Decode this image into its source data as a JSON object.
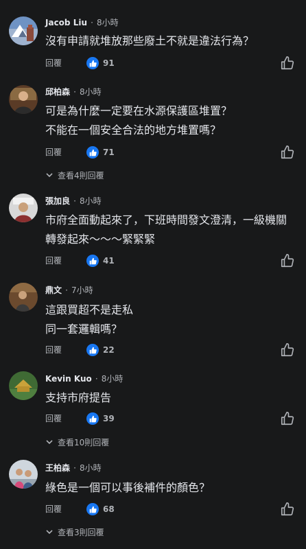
{
  "labels": {
    "reply": "回覆",
    "dot": "·"
  },
  "colors": {
    "background": "#18191a",
    "text_primary": "#e4e6eb",
    "text_secondary": "#b0b3b8",
    "like_accent": "#1877f2"
  },
  "comments": [
    {
      "name": "Jacob Liu",
      "time": "8小時",
      "lines": [
        "沒有申請就堆放那些廢土不就是違法行為？"
      ],
      "likes": "91",
      "view_replies": ""
    },
    {
      "name": "邱柏森",
      "time": "8小時",
      "lines": [
        "可是為什麼一定要在水源保護區堆置？",
        "不能在一個安全合法的地方堆置嗎？"
      ],
      "likes": "71",
      "view_replies": "查看4則回覆"
    },
    {
      "name": "張加良",
      "time": "8小時",
      "lines": [
        "市府全面動起來了，下班時間發文澄清，一級機關",
        "轉發起來～～～緊緊緊"
      ],
      "likes": "41",
      "view_replies": ""
    },
    {
      "name": "鼎文",
      "time": "7小時",
      "lines": [
        "這跟買超不是走私",
        "同一套邏輯嗎？"
      ],
      "likes": "22",
      "view_replies": ""
    },
    {
      "name": "Kevin Kuo",
      "time": "8小時",
      "lines": [
        "支持市府提告"
      ],
      "likes": "39",
      "view_replies": "查看10則回覆"
    },
    {
      "name": "王柏森",
      "time": "8小時",
      "lines": [
        "綠色是一個可以事後補件的顏色？"
      ],
      "likes": "68",
      "view_replies": "查看3則回覆"
    }
  ]
}
